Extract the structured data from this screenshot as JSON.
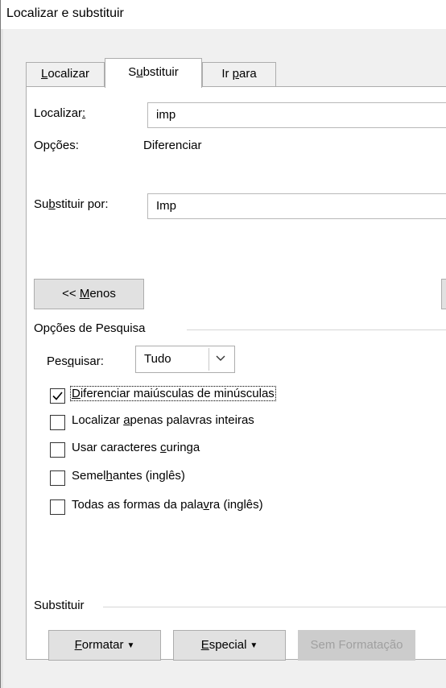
{
  "window": {
    "title": "Localizar e substituir"
  },
  "tabs": [
    {
      "label_pre": "",
      "label_key": "L",
      "label_post": "ocalizar"
    },
    {
      "label_pre": "S",
      "label_key": "u",
      "label_post": "bstituir"
    },
    {
      "label_pre": "Ir ",
      "label_key": "p",
      "label_post": "ara"
    }
  ],
  "find": {
    "label_pre": "Localizar",
    "label_key": ":",
    "label_post": "",
    "value": "imp",
    "options_label": "Opções:",
    "options_value": "Diferenciar"
  },
  "replace": {
    "label_pre": "Su",
    "label_key": "b",
    "label_post": "stituir por:",
    "value": "Imp"
  },
  "less_button": {
    "pre": "<< ",
    "key": "M",
    "post": "enos"
  },
  "search_options": {
    "group_label": "Opções de Pesquisa",
    "search_label_pre": "Pes",
    "search_label_key": "q",
    "search_label_post": "uisar:",
    "search_value": "Tudo",
    "checkboxes": [
      {
        "pre": "",
        "key": "D",
        "post": "iferenciar maiúsculas de minúsculas",
        "checked": true
      },
      {
        "pre": "Localizar ",
        "key": "a",
        "post": "penas palavras inteiras",
        "checked": false
      },
      {
        "pre": "Usar caracteres ",
        "key": "c",
        "post": "uringa",
        "checked": false
      },
      {
        "pre": "Semel",
        "key": "h",
        "post": "antes (inglês)",
        "checked": false
      },
      {
        "pre": "Todas as formas da pala",
        "key": "v",
        "post": "ra (inglês)",
        "checked": false
      }
    ]
  },
  "replace_group": {
    "group_label": "Substituir",
    "format_button": {
      "pre": "",
      "key": "F",
      "post": "ormatar"
    },
    "special_button": {
      "pre": "",
      "key": "E",
      "post": "special"
    },
    "no_format_button": "Sem Formatação"
  },
  "colors": {
    "accent": "#0078d7",
    "dialog_bg": "#f0f0f0",
    "button_bg": "#e1e1e1",
    "disabled_button_bg": "#cccccc"
  }
}
